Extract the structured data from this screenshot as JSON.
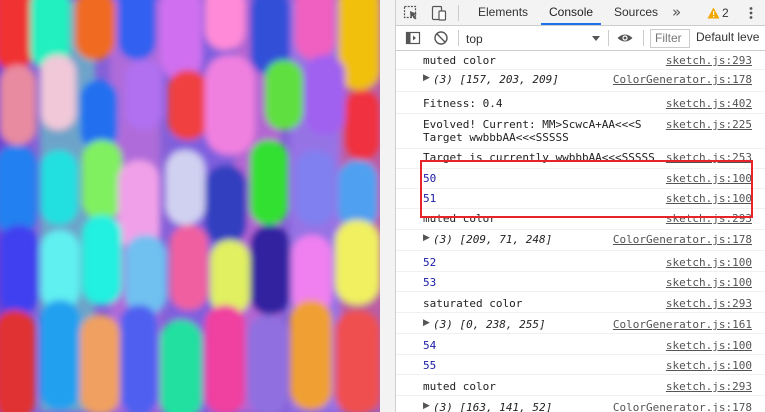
{
  "devtools": {
    "tabs": [
      {
        "label": "Elements",
        "active": false
      },
      {
        "label": "Console",
        "active": true
      },
      {
        "label": "Sources",
        "active": false
      }
    ],
    "more_tabs_icon": "double-chevron-icon",
    "warning_count": "2",
    "warning_icon": "warning-triangle-icon",
    "menu_icon": "kebab-menu-icon",
    "toolbar": {
      "context_value": "top",
      "filter_placeholder": "Filter",
      "levels_label": "Default leve"
    },
    "console_rows": [
      {
        "type": "text",
        "text": "muted color",
        "source": "sketch.js:293"
      },
      {
        "type": "array",
        "text": "(3) [157, 203, 209]",
        "source": "ColorGenerator.js:178"
      },
      {
        "type": "text",
        "text": "Fitness: 0.4",
        "source": "sketch.js:402"
      },
      {
        "type": "text",
        "text": "Evolved! Current: MM>ScwcA+AA<<<S\nTarget wwbbbAA<<<SSSSS",
        "source": "sketch.js:225"
      },
      {
        "type": "text",
        "text": "Target is currently wwbbbAA<<<SSSSS",
        "source": "sketch.js:253"
      },
      {
        "type": "number",
        "text": "50",
        "source": "sketch.js:100"
      },
      {
        "type": "number",
        "text": "51",
        "source": "sketch.js:100"
      },
      {
        "type": "text",
        "text": "muted color",
        "source": "sketch.js:293"
      },
      {
        "type": "array",
        "text": "(3) [209, 71, 248]",
        "source": "ColorGenerator.js:178"
      },
      {
        "type": "number",
        "text": "52",
        "source": "sketch.js:100"
      },
      {
        "type": "number",
        "text": "53",
        "source": "sketch.js:100"
      },
      {
        "type": "text",
        "text": "saturated color",
        "source": "sketch.js:293"
      },
      {
        "type": "array",
        "text": "(3) [0, 238, 255]",
        "source": "ColorGenerator.js:161"
      },
      {
        "type": "number",
        "text": "54",
        "source": "sketch.js:100"
      },
      {
        "type": "number",
        "text": "55",
        "source": "sketch.js:100"
      },
      {
        "type": "text",
        "text": "muted color",
        "source": "sketch.js:293"
      },
      {
        "type": "array",
        "text": "(3) [163, 141, 52]",
        "source": "ColorGenerator.js:178"
      }
    ]
  },
  "colors": {
    "highlight": "#e8232a",
    "accent_tab": "#1a73e8",
    "number_text": "#1a1aa6"
  }
}
